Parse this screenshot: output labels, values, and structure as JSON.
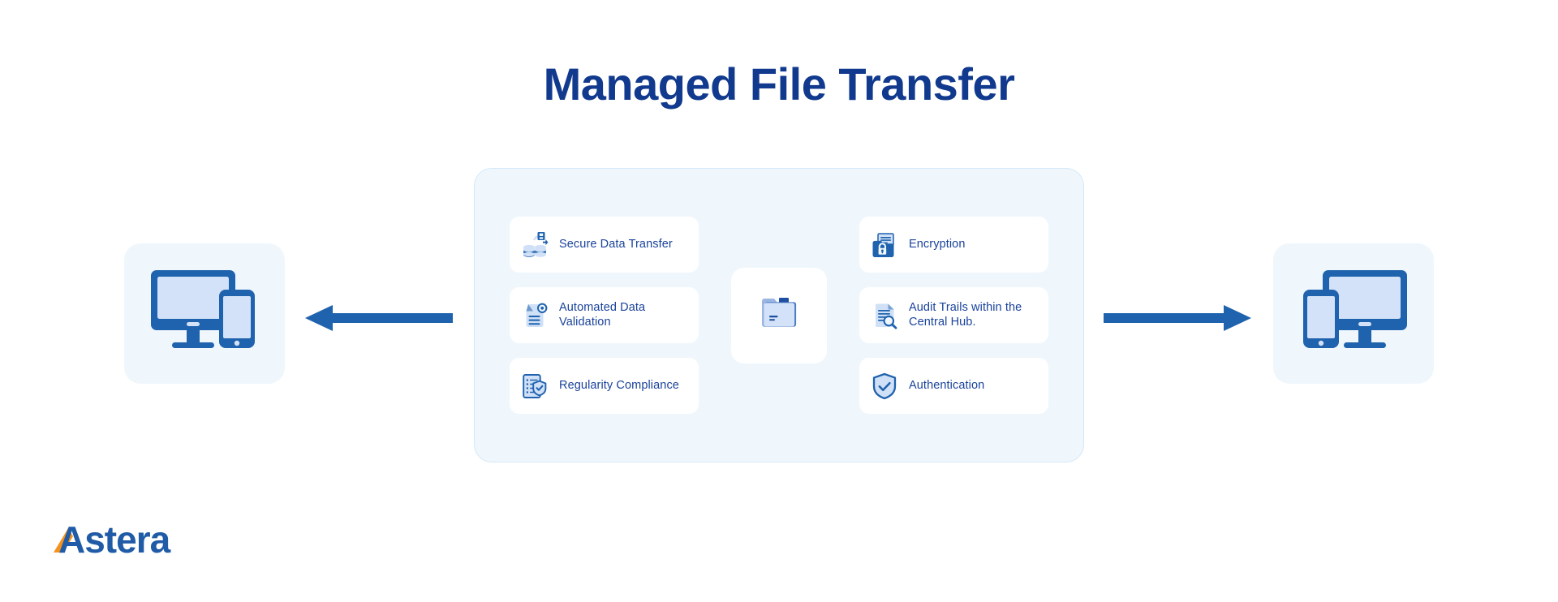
{
  "title": "Managed File Transfer",
  "colors": {
    "title": "#113a8e",
    "panel_bg": "#eff7fd",
    "panel_border": "#d5e9f8",
    "card_bg": "#ffffff",
    "card_text": "#19429b",
    "icon_dark": "#1f62ad",
    "icon_light": "#cfe0f7",
    "arrow": "#1f62ad",
    "logo_blue": "#1f5ba6",
    "logo_orange": "#f5921e"
  },
  "panel": {
    "left_column": [
      {
        "label": "Secure Data Transfer",
        "icon": "secure-data-transfer-icon"
      },
      {
        "label": "Automated Data Validation",
        "icon": "automated-data-validation-icon"
      },
      {
        "label": "Regularity Compliance",
        "icon": "regularity-compliance-icon"
      }
    ],
    "center": {
      "icon": "folder-icon"
    },
    "right_column": [
      {
        "label": "Encryption",
        "icon": "encryption-folder-lock-icon"
      },
      {
        "label": "Audit Trails within the Central Hub.",
        "icon": "audit-trail-search-icon"
      },
      {
        "label": "Authentication",
        "icon": "shield-check-icon"
      }
    ]
  },
  "endpoints": {
    "left": {
      "icon": "monitor-phone-icon"
    },
    "right": {
      "icon": "phone-monitor-icon"
    }
  },
  "arrows": {
    "left": {
      "icon": "arrow-left-icon"
    },
    "right": {
      "icon": "arrow-right-icon"
    }
  },
  "logo": {
    "text": "Astera"
  }
}
